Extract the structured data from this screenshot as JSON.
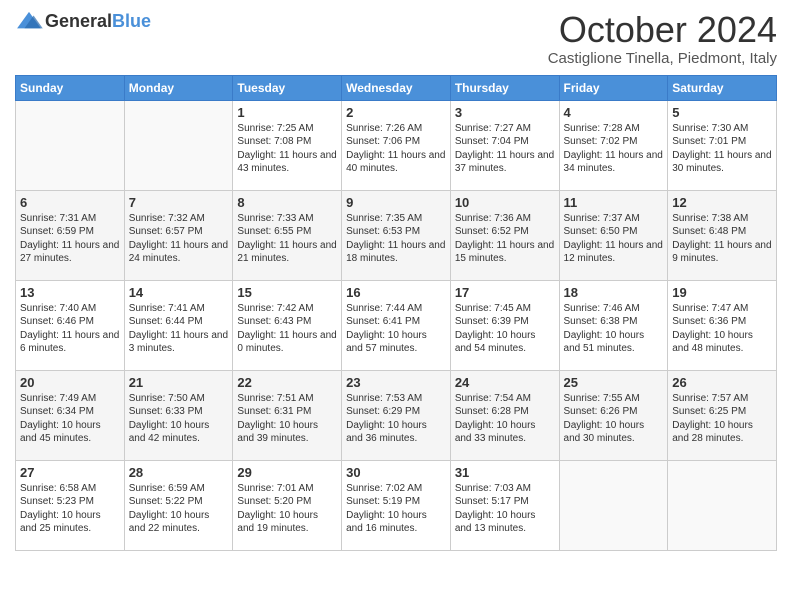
{
  "header": {
    "logo": {
      "general": "General",
      "blue": "Blue"
    },
    "title": "October 2024",
    "location": "Castiglione Tinella, Piedmont, Italy"
  },
  "weekdays": [
    "Sunday",
    "Monday",
    "Tuesday",
    "Wednesday",
    "Thursday",
    "Friday",
    "Saturday"
  ],
  "weeks": [
    [
      {
        "day": "",
        "info": ""
      },
      {
        "day": "",
        "info": ""
      },
      {
        "day": "1",
        "info": "Sunrise: 7:25 AM\nSunset: 7:08 PM\nDaylight: 11 hours and 43 minutes."
      },
      {
        "day": "2",
        "info": "Sunrise: 7:26 AM\nSunset: 7:06 PM\nDaylight: 11 hours and 40 minutes."
      },
      {
        "day": "3",
        "info": "Sunrise: 7:27 AM\nSunset: 7:04 PM\nDaylight: 11 hours and 37 minutes."
      },
      {
        "day": "4",
        "info": "Sunrise: 7:28 AM\nSunset: 7:02 PM\nDaylight: 11 hours and 34 minutes."
      },
      {
        "day": "5",
        "info": "Sunrise: 7:30 AM\nSunset: 7:01 PM\nDaylight: 11 hours and 30 minutes."
      }
    ],
    [
      {
        "day": "6",
        "info": "Sunrise: 7:31 AM\nSunset: 6:59 PM\nDaylight: 11 hours and 27 minutes."
      },
      {
        "day": "7",
        "info": "Sunrise: 7:32 AM\nSunset: 6:57 PM\nDaylight: 11 hours and 24 minutes."
      },
      {
        "day": "8",
        "info": "Sunrise: 7:33 AM\nSunset: 6:55 PM\nDaylight: 11 hours and 21 minutes."
      },
      {
        "day": "9",
        "info": "Sunrise: 7:35 AM\nSunset: 6:53 PM\nDaylight: 11 hours and 18 minutes."
      },
      {
        "day": "10",
        "info": "Sunrise: 7:36 AM\nSunset: 6:52 PM\nDaylight: 11 hours and 15 minutes."
      },
      {
        "day": "11",
        "info": "Sunrise: 7:37 AM\nSunset: 6:50 PM\nDaylight: 11 hours and 12 minutes."
      },
      {
        "day": "12",
        "info": "Sunrise: 7:38 AM\nSunset: 6:48 PM\nDaylight: 11 hours and 9 minutes."
      }
    ],
    [
      {
        "day": "13",
        "info": "Sunrise: 7:40 AM\nSunset: 6:46 PM\nDaylight: 11 hours and 6 minutes."
      },
      {
        "day": "14",
        "info": "Sunrise: 7:41 AM\nSunset: 6:44 PM\nDaylight: 11 hours and 3 minutes."
      },
      {
        "day": "15",
        "info": "Sunrise: 7:42 AM\nSunset: 6:43 PM\nDaylight: 11 hours and 0 minutes."
      },
      {
        "day": "16",
        "info": "Sunrise: 7:44 AM\nSunset: 6:41 PM\nDaylight: 10 hours and 57 minutes."
      },
      {
        "day": "17",
        "info": "Sunrise: 7:45 AM\nSunset: 6:39 PM\nDaylight: 10 hours and 54 minutes."
      },
      {
        "day": "18",
        "info": "Sunrise: 7:46 AM\nSunset: 6:38 PM\nDaylight: 10 hours and 51 minutes."
      },
      {
        "day": "19",
        "info": "Sunrise: 7:47 AM\nSunset: 6:36 PM\nDaylight: 10 hours and 48 minutes."
      }
    ],
    [
      {
        "day": "20",
        "info": "Sunrise: 7:49 AM\nSunset: 6:34 PM\nDaylight: 10 hours and 45 minutes."
      },
      {
        "day": "21",
        "info": "Sunrise: 7:50 AM\nSunset: 6:33 PM\nDaylight: 10 hours and 42 minutes."
      },
      {
        "day": "22",
        "info": "Sunrise: 7:51 AM\nSunset: 6:31 PM\nDaylight: 10 hours and 39 minutes."
      },
      {
        "day": "23",
        "info": "Sunrise: 7:53 AM\nSunset: 6:29 PM\nDaylight: 10 hours and 36 minutes."
      },
      {
        "day": "24",
        "info": "Sunrise: 7:54 AM\nSunset: 6:28 PM\nDaylight: 10 hours and 33 minutes."
      },
      {
        "day": "25",
        "info": "Sunrise: 7:55 AM\nSunset: 6:26 PM\nDaylight: 10 hours and 30 minutes."
      },
      {
        "day": "26",
        "info": "Sunrise: 7:57 AM\nSunset: 6:25 PM\nDaylight: 10 hours and 28 minutes."
      }
    ],
    [
      {
        "day": "27",
        "info": "Sunrise: 6:58 AM\nSunset: 5:23 PM\nDaylight: 10 hours and 25 minutes."
      },
      {
        "day": "28",
        "info": "Sunrise: 6:59 AM\nSunset: 5:22 PM\nDaylight: 10 hours and 22 minutes."
      },
      {
        "day": "29",
        "info": "Sunrise: 7:01 AM\nSunset: 5:20 PM\nDaylight: 10 hours and 19 minutes."
      },
      {
        "day": "30",
        "info": "Sunrise: 7:02 AM\nSunset: 5:19 PM\nDaylight: 10 hours and 16 minutes."
      },
      {
        "day": "31",
        "info": "Sunrise: 7:03 AM\nSunset: 5:17 PM\nDaylight: 10 hours and 13 minutes."
      },
      {
        "day": "",
        "info": ""
      },
      {
        "day": "",
        "info": ""
      }
    ]
  ]
}
